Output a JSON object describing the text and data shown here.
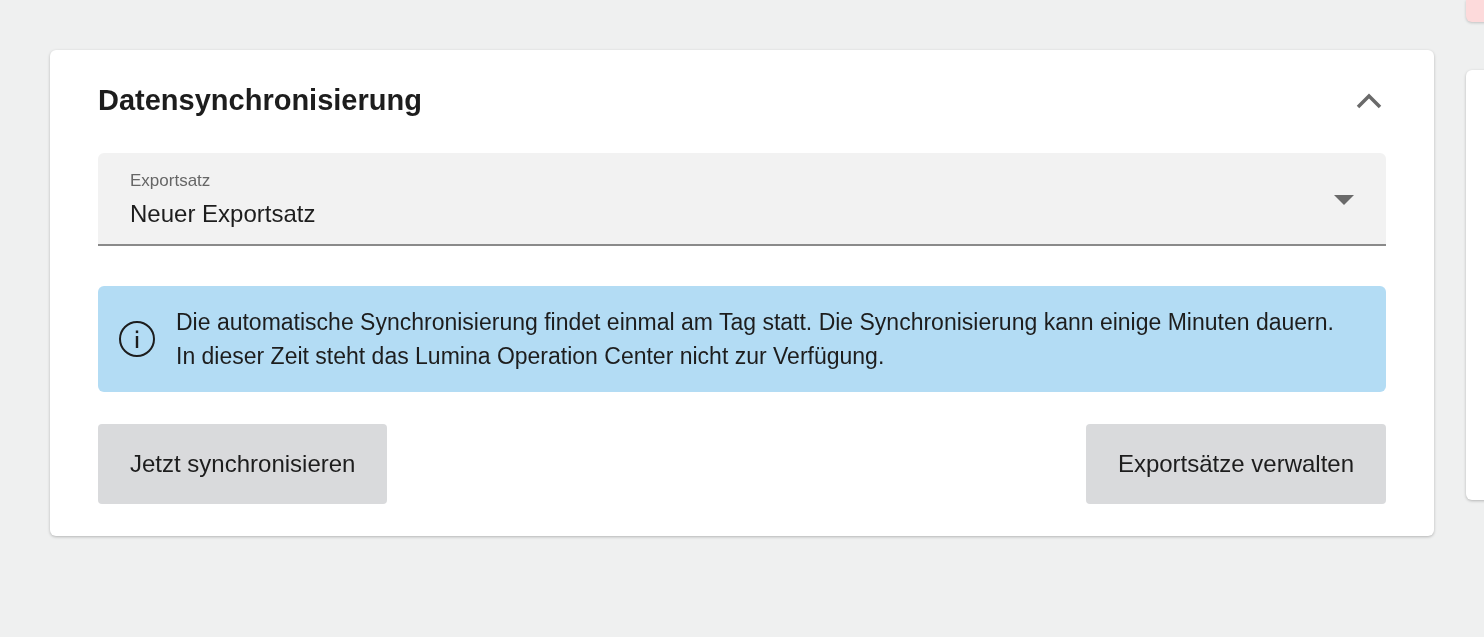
{
  "panel": {
    "title": "Datensynchronisierung",
    "expanded": true,
    "select": {
      "label": "Exportsatz",
      "value": "Neuer Exportsatz"
    },
    "info": "Die automatische Synchronisierung findet einmal am Tag statt. Die Synchronisierung kann einige Minuten dauern. In dieser Zeit steht das Lumina Operation Center nicht zur Verfügung.",
    "buttons": [
      "Jetzt synchronisieren",
      "Exportsätze verwalten"
    ]
  }
}
